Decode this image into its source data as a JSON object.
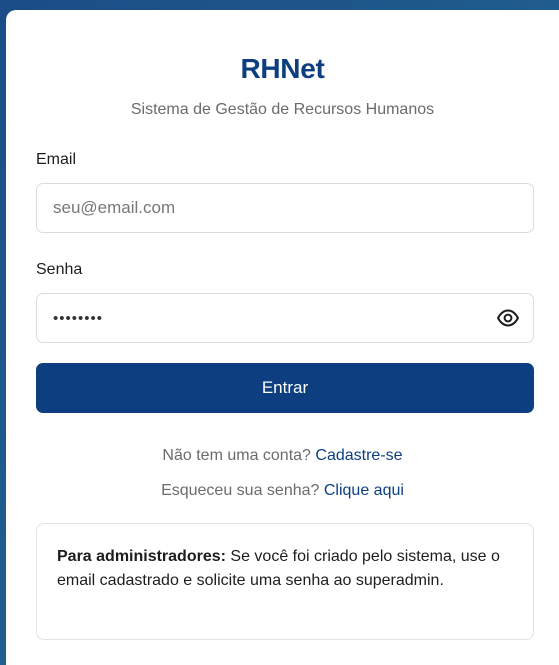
{
  "app": {
    "title": "RHNet",
    "subtitle": "Sistema de Gestão de Recursos Humanos"
  },
  "form": {
    "email_label": "Email",
    "email_placeholder": "seu@email.com",
    "email_value": "",
    "password_label": "Senha",
    "password_value": "12345678",
    "toggle_icon": "eye-icon",
    "submit_label": "Entrar"
  },
  "links": {
    "signup_prompt": "Não tem uma conta?",
    "signup_link": "Cadastre-se",
    "forgot_prompt": "Esqueceu sua senha?",
    "forgot_link": "Clique aqui"
  },
  "notice": {
    "heading": "Para administradores:",
    "body": "Se você foi criado pelo sistema, use o email cadastrado e solicite uma senha ao superadmin."
  },
  "colors": {
    "primary": "#0d3f80",
    "background": "#1b4d86",
    "muted_text": "#6b6b6b"
  }
}
